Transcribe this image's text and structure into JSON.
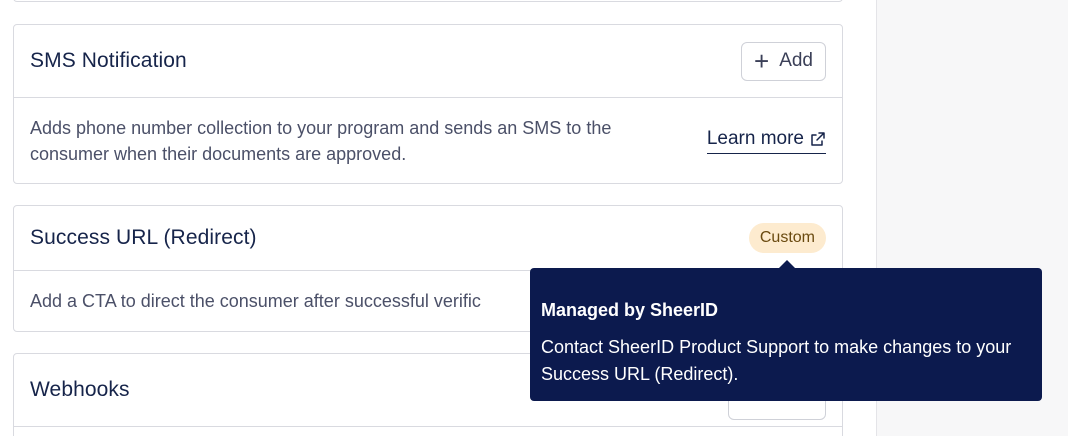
{
  "sms": {
    "title": "SMS Notification",
    "add_label": "Add",
    "description": "Adds phone number collection to your program and sends an SMS to the consumer when their documents are approved.",
    "learn_more": "Learn more"
  },
  "success": {
    "title": "Success URL (Redirect)",
    "badge": "Custom",
    "description": "Add a CTA to direct the consumer after successful verific"
  },
  "webhooks": {
    "title": "Webhooks"
  },
  "tooltip": {
    "title": "Managed by SheerID",
    "body": "Contact SheerID Product Support to make changes to your Success URL (Redirect)."
  },
  "colors": {
    "tooltip_bg": "#0c1a4e",
    "badge_bg": "#fdebcf",
    "title_text": "#16244a"
  }
}
